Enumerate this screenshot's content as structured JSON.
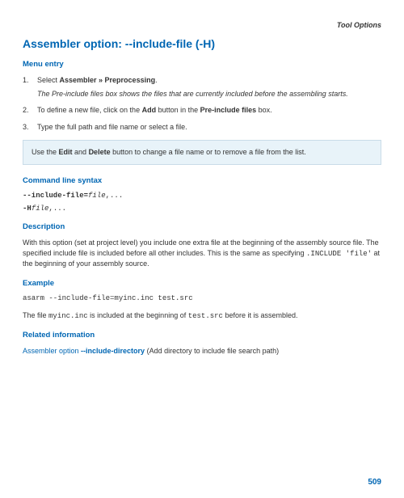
{
  "header": "Tool Options",
  "title": "Assembler option: --include-file (-H)",
  "menuEntry": {
    "heading": "Menu entry",
    "step1_prefix": "Select ",
    "step1_bold": "Assembler » Preprocessing",
    "step1_suffix": ".",
    "step1_sub": "The Pre-include files box shows the files that are currently included before the assembling starts.",
    "step2_prefix": "To define a new file, click on the ",
    "step2_bold1": "Add",
    "step2_mid": " button in the ",
    "step2_bold2": "Pre-include files",
    "step2_suffix": " box.",
    "step3": "Type the full path and file name or select a file."
  },
  "note": {
    "prefix": "Use the ",
    "bold1": "Edit",
    "mid": " and ",
    "bold2": "Delete",
    "suffix": " button to change a file name or to remove a file from the list."
  },
  "cmdSyntax": {
    "heading": "Command line syntax",
    "line1_bold": "--include-file=",
    "line1_italic": "file",
    "line1_rest": ",...",
    "line2_bold": "-H",
    "line2_italic": "file",
    "line2_rest": ",..."
  },
  "description": {
    "heading": "Description",
    "text_pre": "With this option (set at project level) you include one extra file at the beginning of the assembly source file. The specified include file is included before all other includes. This is the same as specifying ",
    "text_mono1": ".INCLUDE 'file'",
    "text_post": " at the beginning of your assembly source."
  },
  "example": {
    "heading": "Example",
    "code": "asarm --include-file=myinc.inc test.src",
    "text_pre": "The file ",
    "text_mono1": "myinc.inc",
    "text_mid": " is included at the beginning of ",
    "text_mono2": "test.src",
    "text_post": " before it is assembled."
  },
  "related": {
    "heading": "Related information",
    "link_prefix": "Assembler option ",
    "link_bold": "--include-directory",
    "link_suffix": " (Add directory to include file search path)"
  },
  "pageNumber": "509"
}
